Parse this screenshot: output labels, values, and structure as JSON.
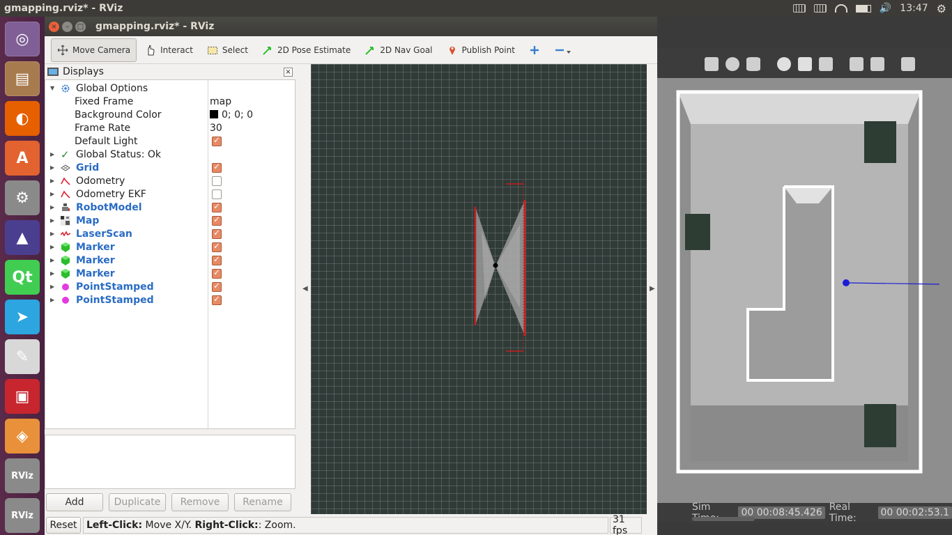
{
  "topbar": {
    "app_title": "gmapping.rviz* - RViz",
    "clock": "13:47"
  },
  "launcher": {
    "items": [
      {
        "name": "ubuntu-dash",
        "glyph": "◎",
        "color": "#7f5f95"
      },
      {
        "name": "files",
        "glyph": "▤",
        "color": "#a87b4e"
      },
      {
        "name": "firefox",
        "glyph": "◐",
        "color": "#e66000"
      },
      {
        "name": "software-center",
        "glyph": "A",
        "color": "#e2632f"
      },
      {
        "name": "system-settings",
        "glyph": "⚙",
        "color": "#8a8a8a"
      },
      {
        "name": "math-app",
        "glyph": "▲",
        "color": "#4a3f8f"
      },
      {
        "name": "qt-creator",
        "glyph": "Qt",
        "color": "#41cd52"
      },
      {
        "name": "telegram",
        "glyph": "➤",
        "color": "#2ca5e0"
      },
      {
        "name": "text-editor",
        "glyph": "✎",
        "color": "#d8d8d8"
      },
      {
        "name": "terminal",
        "glyph": "▣",
        "color": "#c7262f"
      },
      {
        "name": "gazebo",
        "glyph": "◈",
        "color": "#e8913a"
      },
      {
        "name": "rviz-1",
        "glyph": "RViz",
        "color": "#8a8a8a"
      },
      {
        "name": "rviz-2",
        "glyph": "RViz",
        "color": "#8a8a8a"
      }
    ]
  },
  "window": {
    "title": "gmapping.rviz* - RViz"
  },
  "toolbar": {
    "move_camera": "Move Camera",
    "interact": "Interact",
    "select": "Select",
    "pose_estimate": "2D Pose Estimate",
    "nav_goal": "2D Nav Goal",
    "publish_point": "Publish Point"
  },
  "displays": {
    "title": "Displays",
    "global_options": "Global Options",
    "fixed_frame_label": "Fixed Frame",
    "fixed_frame_value": "map",
    "background_color_label": "Background Color",
    "background_color_value": "0; 0; 0",
    "frame_rate_label": "Frame Rate",
    "frame_rate_value": "30",
    "default_light_label": "Default Light",
    "global_status": "Global Status: Ok",
    "items": [
      {
        "label": "Grid",
        "checked": true,
        "bold": true
      },
      {
        "label": "Odometry",
        "checked": false,
        "bold": false
      },
      {
        "label": "Odometry EKF",
        "checked": false,
        "bold": false
      },
      {
        "label": "RobotModel",
        "checked": true,
        "bold": true
      },
      {
        "label": "Map",
        "checked": true,
        "bold": true
      },
      {
        "label": "LaserScan",
        "checked": true,
        "bold": true
      },
      {
        "label": "Marker",
        "checked": true,
        "bold": true
      },
      {
        "label": "Marker",
        "checked": true,
        "bold": true
      },
      {
        "label": "Marker",
        "checked": true,
        "bold": true
      },
      {
        "label": "PointStamped",
        "checked": true,
        "bold": true
      },
      {
        "label": "PointStamped",
        "checked": true,
        "bold": true
      }
    ]
  },
  "buttons": {
    "add": "Add",
    "duplicate": "Duplicate",
    "remove": "Remove",
    "rename": "Rename"
  },
  "statusbar": {
    "reset": "Reset",
    "hint_left_click": "Left-Click:",
    "hint_left_action": " Move X/Y. ",
    "hint_right_click": "Right-Click:",
    "hint_right_action": ": Zoom.",
    "fps": "31 fps"
  },
  "gazebo": {
    "sim_time_label": "Sim Time:",
    "sim_time_value": "00 00:08:45.426",
    "real_time_label": "Real Time:",
    "real_time_value": "00 00:02:53.1"
  },
  "colors": {
    "accent_blue": "#2a6cc4",
    "checkbox_on": "#e78a64",
    "view_bg": "#303b38",
    "laser_red": "#c81e1e"
  }
}
